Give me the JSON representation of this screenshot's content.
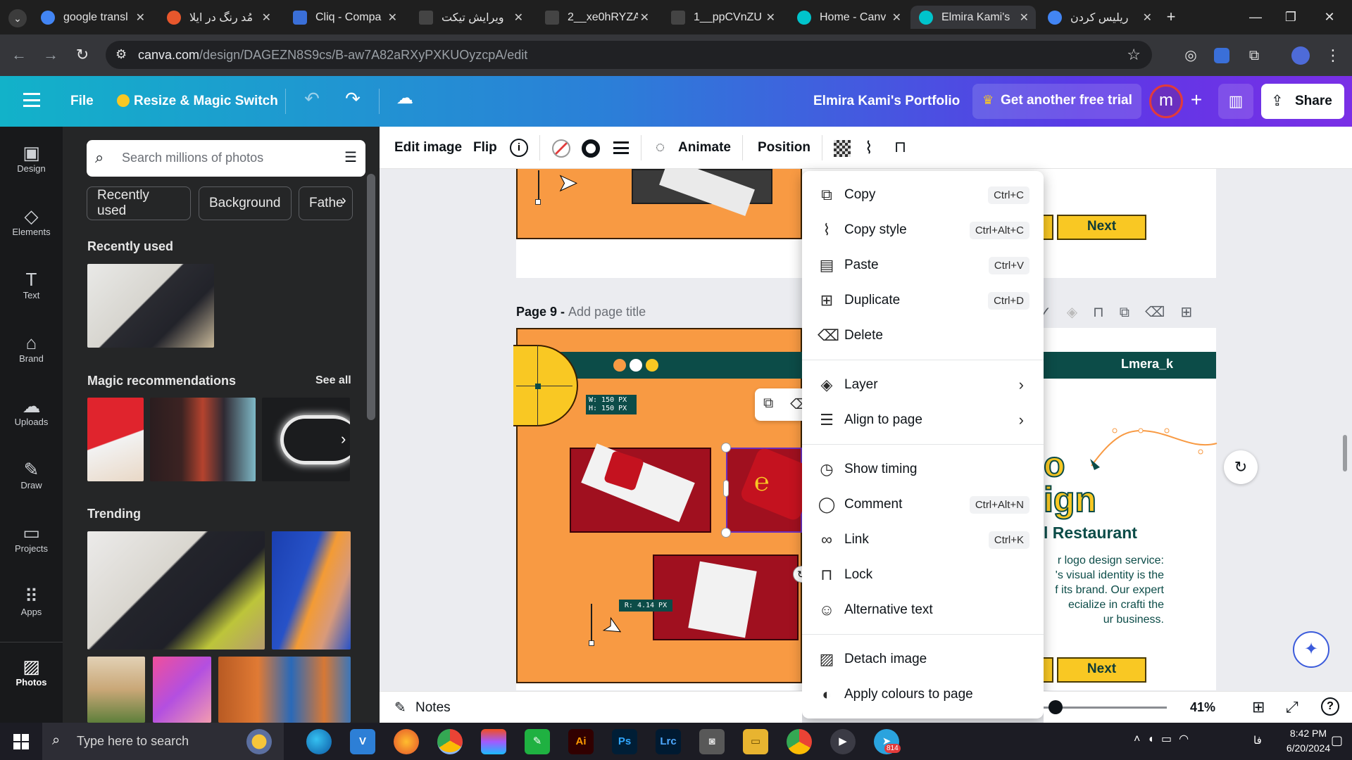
{
  "browser": {
    "tabs": [
      {
        "title": "google transl",
        "favicon_color": "#4285f4"
      },
      {
        "title": "مُد رنگ در ایلا",
        "favicon_color": "#e8572c"
      },
      {
        "title": "Cliq - Compa",
        "favicon_color": "#3a6fd8"
      },
      {
        "title": "ویرایش تیکت",
        "favicon_color": "#444444"
      },
      {
        "title": "2__xe0hRYZA",
        "favicon_color": "#444444"
      },
      {
        "title": "1__ppCVnZU",
        "favicon_color": "#444444"
      },
      {
        "title": "Home - Canv",
        "favicon_color": "#00c4cc"
      },
      {
        "title": "Elmira Kami's",
        "favicon_color": "#00c4cc"
      },
      {
        "title": "ریلیس کردن",
        "favicon_color": "#4285f4"
      }
    ],
    "active_tab_index": 7,
    "url_domain": "canva.com",
    "url_path": "/design/DAGEZN8S9cs/B-aw7A82aRXyPXKUOyzcpA/edit"
  },
  "topbar": {
    "file_label": "File",
    "resize_label": "Resize & Magic Switch",
    "design_title": "Elmira Kami's Portfolio",
    "trial_label": "Get another free trial",
    "avatar_letter": "m",
    "share_label": "Share"
  },
  "rail": {
    "items": [
      {
        "label": "Design",
        "icon": "design-icon"
      },
      {
        "label": "Elements",
        "icon": "elements-icon"
      },
      {
        "label": "Text",
        "icon": "text-icon"
      },
      {
        "label": "Brand",
        "icon": "brand-icon"
      },
      {
        "label": "Uploads",
        "icon": "uploads-icon"
      },
      {
        "label": "Draw",
        "icon": "draw-icon"
      },
      {
        "label": "Projects",
        "icon": "projects-icon"
      },
      {
        "label": "Apps",
        "icon": "apps-icon"
      },
      {
        "label": "Photos",
        "icon": "photos-icon"
      }
    ]
  },
  "panel": {
    "search_placeholder": "Search millions of photos",
    "chips": [
      "Recently used",
      "Background",
      "Fathe"
    ],
    "recently_used_heading": "Recently used",
    "magic_heading": "Magic recommendations",
    "see_all": "See all",
    "trending_heading": "Trending"
  },
  "toolbar": {
    "edit_image": "Edit image",
    "flip": "Flip",
    "animate": "Animate",
    "position": "Position"
  },
  "canvas": {
    "page_label": "Page 9 - ",
    "page_title_placeholder": "Add page title",
    "size_readout_w": "W: 150 PX",
    "size_readout_h": "H: 150 PX",
    "rotation_readout": "R: 4.14 PX",
    "next_label": "Next",
    "brand_handle": "Lmera_k",
    "headline_partial_1": "o",
    "headline_partial_2": "ign",
    "subhead": "l Restaurant",
    "body_lines": [
      "r logo design service:",
      "'s visual identity is the",
      "f its brand. Our expert",
      "ecialize in crafti the",
      "ur business."
    ]
  },
  "context_menu": {
    "items": [
      {
        "label": "Copy",
        "shortcut": "Ctrl+C",
        "icon": "copy-icon"
      },
      {
        "label": "Copy style",
        "shortcut": "Ctrl+Alt+C",
        "icon": "paint-roller-icon"
      },
      {
        "label": "Paste",
        "shortcut": "Ctrl+V",
        "icon": "clipboard-icon"
      },
      {
        "label": "Duplicate",
        "shortcut": "Ctrl+D",
        "icon": "duplicate-icon"
      },
      {
        "label": "Delete",
        "shortcut": "",
        "icon": "trash-icon"
      },
      {
        "label": "Layer",
        "shortcut": "",
        "icon": "layers-icon"
      },
      {
        "label": "Align to page",
        "shortcut": "",
        "icon": "align-icon"
      },
      {
        "label": "Show timing",
        "shortcut": "",
        "icon": "clock-icon"
      },
      {
        "label": "Comment",
        "shortcut": "Ctrl+Alt+N",
        "icon": "comment-icon"
      },
      {
        "label": "Link",
        "shortcut": "Ctrl+K",
        "icon": "link-icon"
      },
      {
        "label": "Lock",
        "shortcut": "",
        "icon": "lock-icon"
      },
      {
        "label": "Alternative text",
        "shortcut": "",
        "icon": "accessibility-icon"
      },
      {
        "label": "Detach image",
        "shortcut": "",
        "icon": "detach-icon"
      },
      {
        "label": "Apply colours to page",
        "shortcut": "",
        "icon": "palette-icon"
      }
    ]
  },
  "footer": {
    "notes_label": "Notes",
    "zoom": "41%"
  },
  "taskbar": {
    "search_placeholder": "Type here to search",
    "time": "8:42 PM",
    "date": "6/20/2024",
    "lang": "فا",
    "telegram_badge": "814"
  }
}
